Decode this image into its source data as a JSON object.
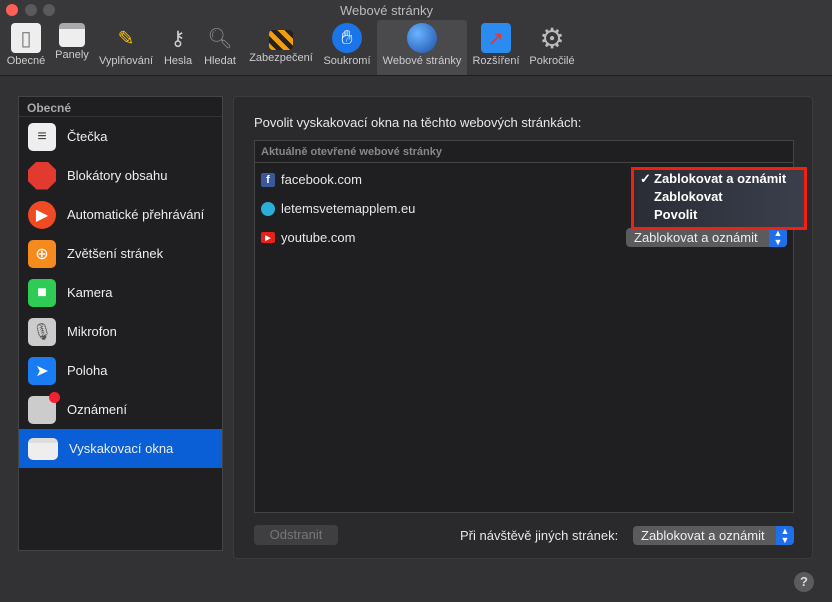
{
  "window": {
    "title": "Webové stránky"
  },
  "toolbar": [
    {
      "label": "Obecné",
      "icon": "switch-icon"
    },
    {
      "label": "Panely",
      "icon": "tabs-icon"
    },
    {
      "label": "Vyplňování",
      "icon": "pencil-icon"
    },
    {
      "label": "Hesla",
      "icon": "key-icon"
    },
    {
      "label": "Hledat",
      "icon": "magnifier-icon"
    },
    {
      "label": "Zabezpečení",
      "icon": "lock-icon"
    },
    {
      "label": "Soukromí",
      "icon": "hand-icon"
    },
    {
      "label": "Webové stránky",
      "icon": "globe-icon",
      "selected": true
    },
    {
      "label": "Rozšíření",
      "icon": "puzzle-icon"
    },
    {
      "label": "Pokročilé",
      "icon": "gear-icon"
    }
  ],
  "sidebar": {
    "header": "Obecné",
    "items": [
      {
        "label": "Čtečka",
        "icon": "reader-icon"
      },
      {
        "label": "Blokátory obsahu",
        "icon": "stop-icon"
      },
      {
        "label": "Automatické přehrávání",
        "icon": "play-icon"
      },
      {
        "label": "Zvětšení stránek",
        "icon": "zoom-icon"
      },
      {
        "label": "Kamera",
        "icon": "camera-icon"
      },
      {
        "label": "Mikrofon",
        "icon": "microphone-icon"
      },
      {
        "label": "Poloha",
        "icon": "location-icon"
      },
      {
        "label": "Oznámení",
        "icon": "notification-icon"
      },
      {
        "label": "Vyskakovací okna",
        "icon": "popup-window-icon",
        "selected": true
      }
    ]
  },
  "main": {
    "label": "Povolit vyskakovací okna na těchto webových stránkách:",
    "table_header": "Aktuálně otevřené webové stránky",
    "sites": [
      {
        "name": "facebook.com",
        "setting": "Zablokovat a oznámit"
      },
      {
        "name": "letemsvetemapplem.eu",
        "setting": "Zablokovat a oznámit"
      },
      {
        "name": "youtube.com",
        "setting": "Zablokovat a oznámit"
      }
    ],
    "menu": {
      "options": [
        "Zablokovat a oznámit",
        "Zablokovat",
        "Povolit"
      ],
      "checked": "Zablokovat a oznámit",
      "highlight_color": "#f51e0f"
    },
    "remove_label": "Odstranit",
    "other_label": "Při návštěvě jiných stránek:",
    "other_value": "Zablokovat a oznámit"
  },
  "help": "?"
}
